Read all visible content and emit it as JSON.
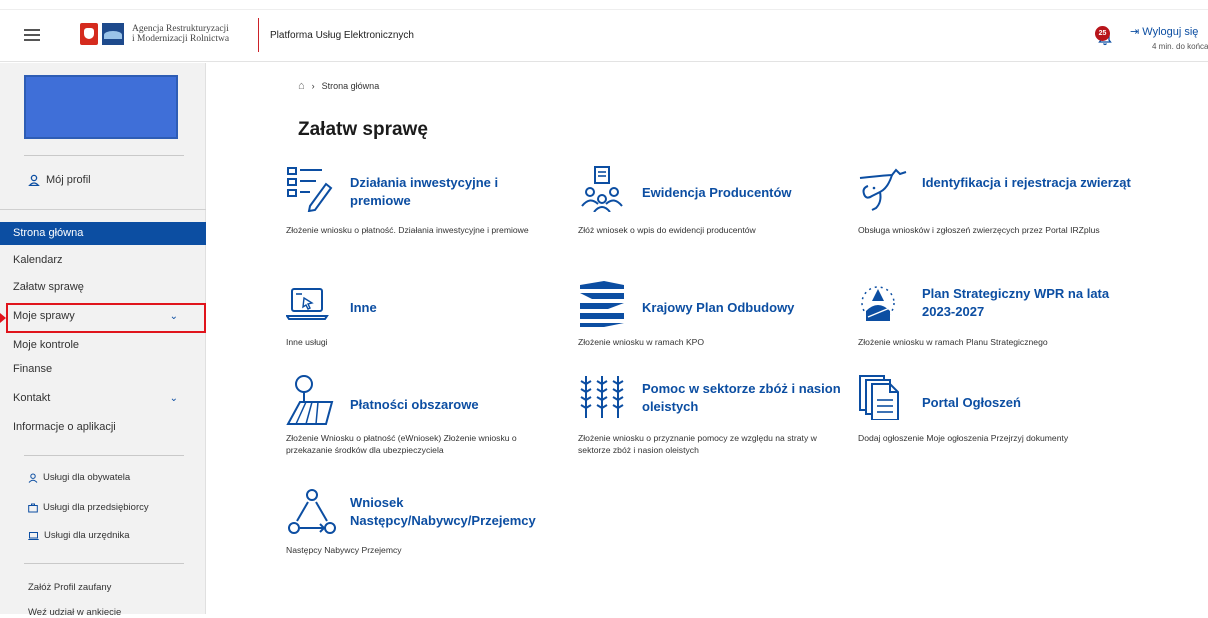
{
  "header": {
    "logo_line1": "Agencja Restrukturyzacji",
    "logo_line2": "i Modernizacji Rolnictwa",
    "platform_name": "Platforma Usług Elektronicznych",
    "notification_count": "25",
    "logout_label": "Wyloguj się",
    "session_remaining": "4 min. do końca"
  },
  "sidebar": {
    "profile_label": "Mój profil",
    "nav": [
      {
        "label": "Strona główna"
      },
      {
        "label": "Kalendarz"
      },
      {
        "label": "Załatw sprawę"
      },
      {
        "label": "Moje sprawy"
      },
      {
        "label": "Moje kontrole"
      },
      {
        "label": "Finanse"
      },
      {
        "label": "Kontakt"
      },
      {
        "label": "Informacje o aplikacji"
      }
    ],
    "services": [
      {
        "label": "Usługi dla obywatela",
        "icon": "person-icon"
      },
      {
        "label": "Usługi dla przedsiębiorcy",
        "icon": "briefcase-icon"
      },
      {
        "label": "Usługi dla urzędnika",
        "icon": "laptop-icon"
      }
    ],
    "extra": [
      {
        "label": "Załóż Profil zaufany"
      },
      {
        "label": "Weź udział w ankiecie"
      }
    ]
  },
  "breadcrumb": {
    "current": "Strona główna"
  },
  "main": {
    "title": "Załatw sprawę",
    "tiles": [
      {
        "name": "Działania inwestycyjne i premiowe",
        "desc": "Złożenie wniosku o płatność. Działania inwestycyjne i premiowe",
        "icon": "form-pen-icon"
      },
      {
        "name": "Ewidencja Producentów",
        "desc": "Złóż wniosek o wpis do ewidencji producentów",
        "icon": "people-register-icon"
      },
      {
        "name": "Identyfikacja i rejestracja zwierząt",
        "desc": "Obsługa wniosków i zgłoszeń zwierzęcych przez Portal IRZplus",
        "icon": "cow-icon"
      },
      {
        "name": "Inne",
        "desc": "Inne usługi",
        "icon": "laptop-cursor-icon"
      },
      {
        "name": "Krajowy Plan Odbudowy",
        "desc": "Złożenie wniosku w ramach KPO",
        "icon": "kpo-logo-icon"
      },
      {
        "name": "Plan Strategiczny WPR na lata 2023-2027",
        "desc": "Złożenie wniosku w ramach Planu Strategicznego",
        "icon": "eu-stars-icon"
      },
      {
        "name": "Płatności obszarowe",
        "desc": "Złożenie Wniosku o płatność (eWniosek) Złożenie wniosku o przekazanie środków dla ubezpieczyciela",
        "icon": "field-tree-icon"
      },
      {
        "name": "Pomoc w sektorze zbóż i nasion oleistych",
        "desc": "Złożenie wniosku o przyznanie pomocy ze względu na straty w sektorze zbóż i nasion oleistych",
        "icon": "grain-icon"
      },
      {
        "name": "Portal Ogłoszeń",
        "desc": "Dodaj ogłoszenie Moje ogłoszenia Przejrzyj dokumenty",
        "icon": "documents-icon"
      },
      {
        "name": "Wniosek Następcy/Nabywcy/Przejemcy",
        "desc": "Następcy Nabywcy Przejemcy",
        "icon": "cycle-people-icon"
      }
    ]
  },
  "colors": {
    "accent": "#0c4ea2",
    "highlight": "#e0141c",
    "badge": "#b8151b"
  }
}
